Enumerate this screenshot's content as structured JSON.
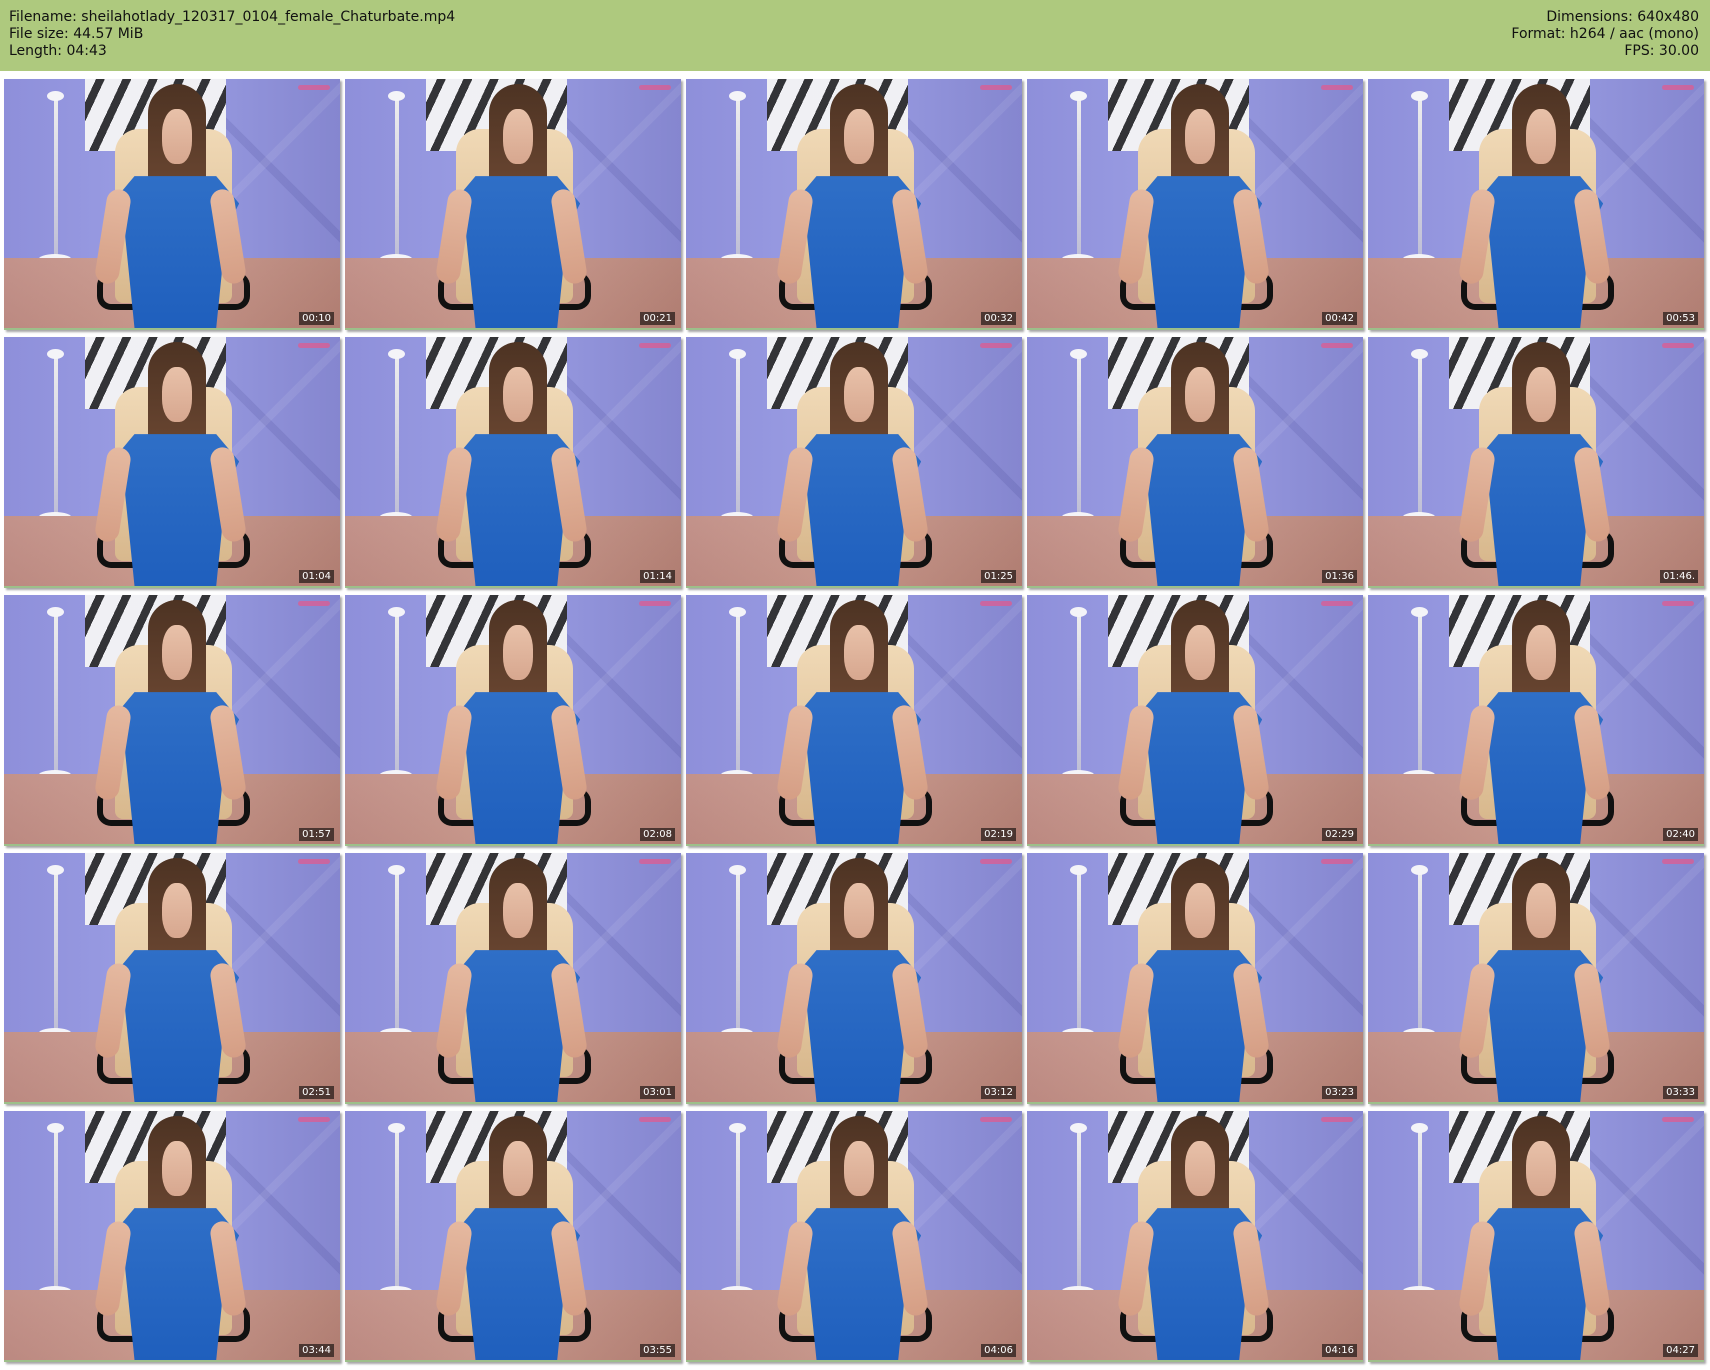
{
  "header": {
    "left": [
      "Filename: sheilahotlady_120317_0104_female_Chaturbate.mp4",
      "File size: 44.57 MiB",
      "Length: 04:43"
    ],
    "right": [
      "Dimensions: 640x480",
      "Format: h264 / aac (mono)",
      "FPS: 30.00"
    ]
  },
  "thumbnails": [
    {
      "timestamp": "00:10"
    },
    {
      "timestamp": "00:21"
    },
    {
      "timestamp": "00:32"
    },
    {
      "timestamp": "00:42"
    },
    {
      "timestamp": "00:53"
    },
    {
      "timestamp": "01:04"
    },
    {
      "timestamp": "01:14"
    },
    {
      "timestamp": "01:25"
    },
    {
      "timestamp": "01:36"
    },
    {
      "timestamp": "01:46."
    },
    {
      "timestamp": "01:57"
    },
    {
      "timestamp": "02:08"
    },
    {
      "timestamp": "02:19"
    },
    {
      "timestamp": "02:29"
    },
    {
      "timestamp": "02:40"
    },
    {
      "timestamp": "02:51"
    },
    {
      "timestamp": "03:01"
    },
    {
      "timestamp": "03:12"
    },
    {
      "timestamp": "03:23"
    },
    {
      "timestamp": "03:33"
    },
    {
      "timestamp": "03:44"
    },
    {
      "timestamp": "03:55"
    },
    {
      "timestamp": "04:06"
    },
    {
      "timestamp": "04:16"
    },
    {
      "timestamp": "04:27"
    }
  ]
}
